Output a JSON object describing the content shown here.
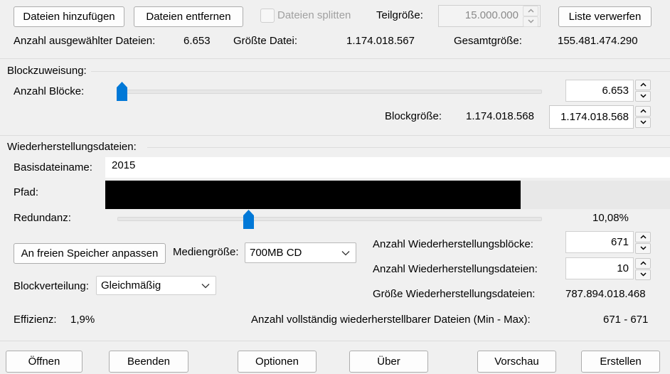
{
  "toolbar": {
    "add_files": "Dateien hinzufügen",
    "remove_files": "Dateien entfernen",
    "split_files": "Dateien splitten",
    "part_size_label": "Teilgröße:",
    "part_size_value": "15.000.000",
    "discard_list": "Liste verwerfen"
  },
  "stats": {
    "selected_count_label": "Anzahl ausgewählter Dateien:",
    "selected_count_value": "6.653",
    "largest_file_label": "Größte Datei:",
    "largest_file_value": "1.174.018.567",
    "total_size_label": "Gesamtgröße:",
    "total_size_value": "155.481.474.290"
  },
  "block_allocation": {
    "group_title": "Blockzuweisung:",
    "block_count_label": "Anzahl Blöcke:",
    "block_count_value": "6.653",
    "block_count_slider_fraction": 0.0,
    "block_size_label": "Blockgröße:",
    "block_size_text": "1.174.018.568",
    "block_size_value": "1.174.018.568"
  },
  "recovery": {
    "group_title": "Wiederherstellungsdateien:",
    "base_name_label": "Basisdateiname:",
    "base_name_value": "2015",
    "path_label": "Pfad:",
    "redundancy_label": "Redundanz:",
    "redundancy_value": "10,08%",
    "redundancy_slider_fraction": 0.31,
    "fit_free_space_button": "An freien Speicher anpassen",
    "media_size_label": "Mediengröße:",
    "media_size_selected": "700MB CD",
    "block_distribution_label": "Blockverteilung:",
    "block_distribution_selected": "Gleichmäßig",
    "efficiency_label": "Effizienz:",
    "efficiency_value": "1,9%",
    "recovery_blocks_label": "Anzahl Wiederherstellungsblöcke:",
    "recovery_blocks_value": "671",
    "recovery_files_label": "Anzahl Wiederherstellungsdateien:",
    "recovery_files_value": "10",
    "recovery_files_size_label": "Größe Wiederherstellungsdateien:",
    "recovery_files_size_value": "787.894.018.468",
    "fully_recoverable_label": "Anzahl vollständig wiederherstellbarer Dateien (Min - Max):",
    "fully_recoverable_value": "671 - 671"
  },
  "footer": {
    "open": "Öffnen",
    "quit": "Beenden",
    "options": "Optionen",
    "about": "Über",
    "preview": "Vorschau",
    "create": "Erstellen"
  },
  "colors": {
    "accent": "#0078d7",
    "background": "#f0f0f0",
    "redacted": "#000000"
  },
  "icons": {
    "spin_up": "chevron-up-icon",
    "spin_down": "chevron-down-icon",
    "combo_arrow": "chevron-down-icon",
    "slider_thumb": "slider-thumb-icon"
  }
}
